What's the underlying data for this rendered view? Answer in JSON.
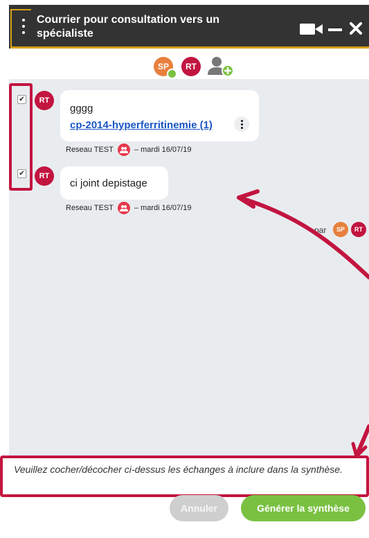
{
  "header": {
    "title": "Courrier pour consultation vers un spécialiste",
    "menu_icon": "kebab-menu-icon",
    "video_icon": "video-camera-icon",
    "minimize_icon": "minimize-icon",
    "close_icon": "close-icon"
  },
  "participants": [
    {
      "initials": "SP",
      "color": "#e8803e"
    },
    {
      "initials": "RT",
      "color": "#c21540"
    }
  ],
  "add_participant_icon": "add-user-icon",
  "messages": [
    {
      "avatar": "RT",
      "text": "gggg",
      "link": "cp-2014-hyperferritinemie (1)",
      "sender": "Reseau TEST",
      "date": "– mardi 16/07/19",
      "checked": true
    },
    {
      "avatar": "RT",
      "text": "ci joint depistage",
      "sender": "Reseau TEST",
      "date": "– mardi 16/07/19",
      "checked": true
    }
  ],
  "seen_by": {
    "label": "par",
    "avatars": [
      "SP",
      "RT"
    ]
  },
  "instruction": "Veuillez cocher/décocher ci-dessus les échanges à inclure dans la synthèse.",
  "buttons": {
    "cancel": "Annuler",
    "generate": "Générer la synthèse"
  },
  "colors": {
    "header_bg": "#333333",
    "highlight": "#c21540",
    "accent_green": "#7ac142",
    "sp_orange": "#e8803e",
    "rt_red": "#c21540"
  }
}
